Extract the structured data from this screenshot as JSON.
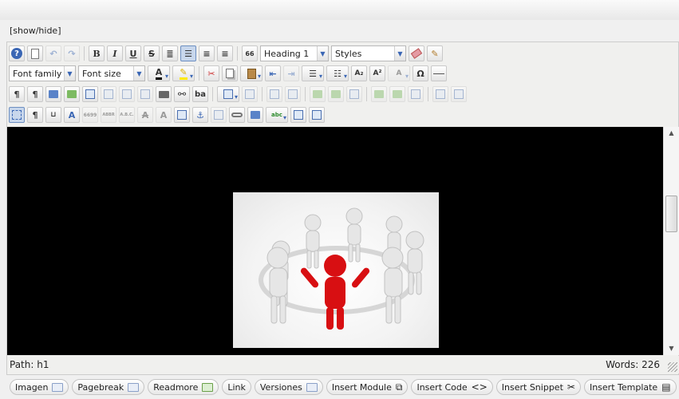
{
  "show_hide": "[show/hide]",
  "toolbar": {
    "format_select": "Heading 1",
    "styles_select": "Styles",
    "font_family": "Font family",
    "font_size": "Font size",
    "bold": "B",
    "italic": "I",
    "underline": "U",
    "strike": "S",
    "special_char": "Ω",
    "subscript": "A₂",
    "superscript": "A²",
    "blockquote": "66",
    "abbr": "ABBR",
    "acronym": "A.B.C.",
    "citation": "6699",
    "spellcheck": "abc"
  },
  "image": {
    "description": "group of white 3D figures holding hands in a circle around a red figure with arms raised"
  },
  "status": {
    "path_label": "Path:",
    "path_value": "h1",
    "words_label": "Words: 226"
  },
  "bottom_buttons": [
    "Imagen",
    "Pagebreak",
    "Readmore",
    "Link",
    "Versiones",
    "Insert Module",
    "Insert Code",
    "Insert Snippet",
    "Insert Template"
  ],
  "colors": {
    "content_bg": "#000000",
    "accent": "#3a66b4",
    "red_figure": "#d80f12"
  }
}
